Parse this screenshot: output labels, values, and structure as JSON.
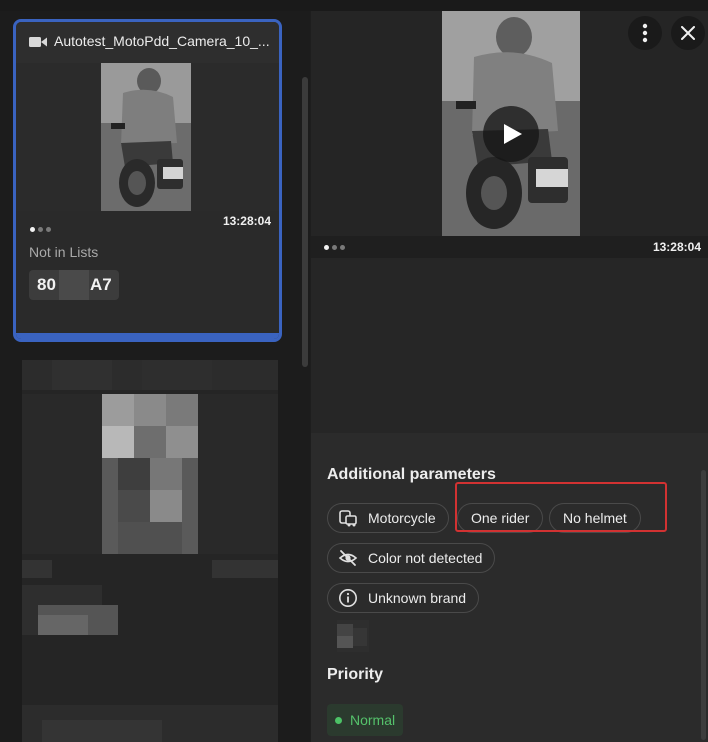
{
  "event_card": {
    "title": "Autotest_MotoPdd_Camera_10_...",
    "time": "13:28:04",
    "status": "Not in Lists",
    "plate_start": "80",
    "plate_end": "A7"
  },
  "viewer": {
    "time": "13:28:04",
    "menu_icon": "more-vertical-icon",
    "close_icon": "close-icon",
    "play_icon": "play-icon"
  },
  "additional_parameters": {
    "title": "Additional parameters",
    "chips": {
      "vehicle_type": "Motorcycle",
      "rider_count": "One rider",
      "helmet": "No helmet",
      "color": "Color not detected",
      "brand": "Unknown brand"
    }
  },
  "priority": {
    "title": "Priority",
    "value": "Normal"
  },
  "colors": {
    "accent": "#3a63c0",
    "highlight": "#d23232",
    "priority_green": "#4cc266"
  }
}
